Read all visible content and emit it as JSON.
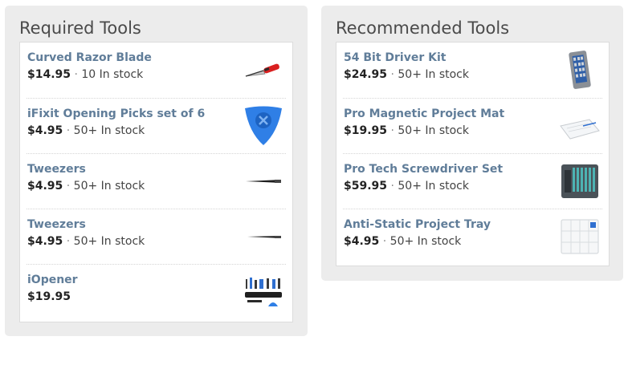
{
  "required": {
    "title": "Required Tools",
    "items": [
      {
        "name": "Curved Razor Blade",
        "price": "$14.95",
        "stock": "10 In stock",
        "icon": "razor-blade-icon"
      },
      {
        "name": "iFixit Opening Picks set of 6",
        "price": "$4.95",
        "stock": "50+ In stock",
        "icon": "opening-pick-icon"
      },
      {
        "name": "Tweezers",
        "price": "$4.95",
        "stock": "50+ In stock",
        "icon": "tweezers-icon"
      },
      {
        "name": "Tweezers",
        "price": "$4.95",
        "stock": "50+ In stock",
        "icon": "tweezers-icon"
      },
      {
        "name": "iOpener",
        "price": "$19.95",
        "stock": "",
        "icon": "iopener-kit-icon"
      }
    ]
  },
  "recommended": {
    "title": "Recommended Tools",
    "items": [
      {
        "name": "54 Bit Driver Kit",
        "price": "$24.95",
        "stock": "50+ In stock",
        "icon": "driver-kit-icon"
      },
      {
        "name": "Pro Magnetic Project Mat",
        "price": "$19.95",
        "stock": "50+ In stock",
        "icon": "project-mat-icon"
      },
      {
        "name": "Pro Tech Screwdriver Set",
        "price": "$59.95",
        "stock": "50+ In stock",
        "icon": "screwdriver-set-icon"
      },
      {
        "name": "Anti-Static Project Tray",
        "price": "$4.95",
        "stock": "50+ In stock",
        "icon": "project-tray-icon"
      }
    ]
  },
  "separator": "·"
}
